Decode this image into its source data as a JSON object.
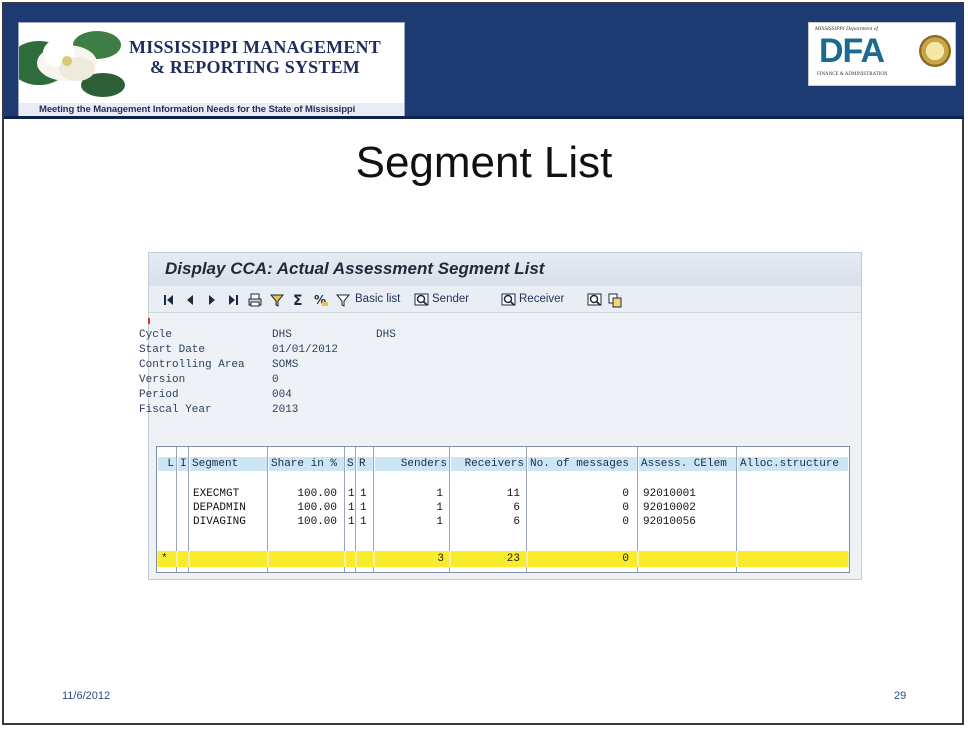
{
  "header": {
    "logo_line1": "MISSISSIPPI MANAGEMENT",
    "logo_line2": "& REPORTING SYSTEM",
    "tagline": "Meeting the Management Information Needs for the State of Mississippi",
    "dfa_top": "MISSISSIPPI Department of",
    "dfa_letters": "DFA",
    "dfa_bottom": "FINANCE & ADMINISTRATION"
  },
  "slide": {
    "title": "Segment List",
    "date": "11/6/2012",
    "page_number": "29"
  },
  "sap": {
    "window_title": "Display CCA: Actual Assessment Segment List",
    "toolbar": {
      "basic_list": "Basic list",
      "sender": "Sender",
      "receiver": "Receiver"
    },
    "header_fields": [
      {
        "label": "Cycle",
        "value": "DHS",
        "value2": "DHS"
      },
      {
        "label": "Start Date",
        "value": "01/01/2012",
        "value2": ""
      },
      {
        "label": "Controlling Area",
        "value": "SOMS",
        "value2": ""
      },
      {
        "label": "Version",
        "value": "0",
        "value2": ""
      },
      {
        "label": "Period",
        "value": "004",
        "value2": ""
      },
      {
        "label": "Fiscal Year",
        "value": "2013",
        "value2": ""
      }
    ],
    "columns": [
      "L",
      "I",
      "Segment",
      "Share in %",
      "S",
      "R",
      "Senders",
      "Receivers",
      "No. of messages",
      "Assess. CElem",
      "Alloc.structure"
    ],
    "rows": [
      {
        "segment": "EXECMGT",
        "share": "100.00",
        "s": "1",
        "r": "1",
        "senders": "1",
        "receivers": "11",
        "messages": "0",
        "celem": "92010001",
        "alloc": ""
      },
      {
        "segment": "DEPADMIN",
        "share": "100.00",
        "s": "1",
        "r": "1",
        "senders": "1",
        "receivers": "6",
        "messages": "0",
        "celem": "92010002",
        "alloc": ""
      },
      {
        "segment": "DIVAGING",
        "share": "100.00",
        "s": "1",
        "r": "1",
        "senders": "1",
        "receivers": "6",
        "messages": "0",
        "celem": "92010056",
        "alloc": ""
      }
    ],
    "totals": {
      "marker": "*",
      "senders": "3",
      "receivers": "23",
      "messages": "0"
    }
  }
}
